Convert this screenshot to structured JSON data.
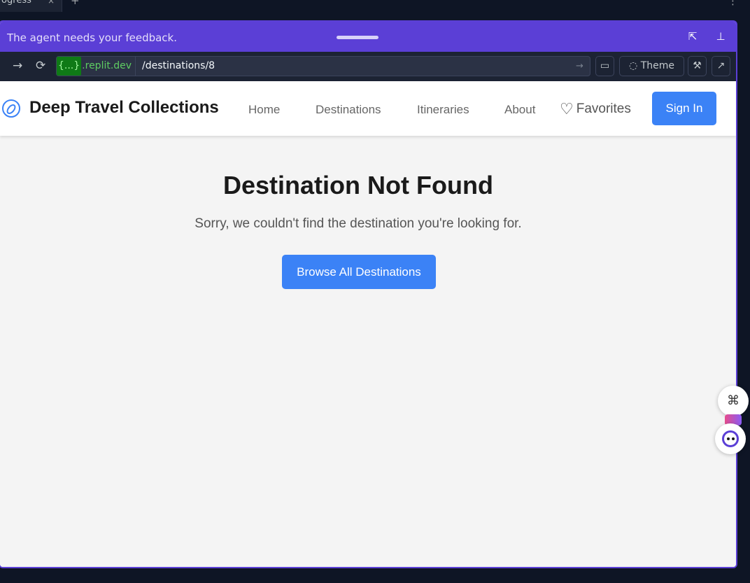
{
  "browser": {
    "tab_label": "rogress",
    "tab_close": "×",
    "tab_add": "+",
    "more": "⋮"
  },
  "feedback_bar": {
    "text": "The agent needs your feedback.",
    "accent": "#5b3fd6"
  },
  "urlbar": {
    "domain_prefix": "{...}",
    "domain": ".replit.dev",
    "path": "/destinations/8",
    "theme_label": "Theme"
  },
  "site": {
    "brand": "Deep Travel Collections",
    "nav": [
      "Home",
      "Destinations",
      "Itineraries",
      "About"
    ],
    "favorites": "Favorites",
    "sign_in": "Sign In",
    "accent": "#3b82f6"
  },
  "main": {
    "title": "Destination Not Found",
    "message": "Sorry, we couldn't find the destination you're looking for.",
    "browse_button": "Browse All Destinations"
  },
  "icons": {
    "back": "→",
    "reload": "⟳",
    "go": "→",
    "devices": "▭",
    "theme": "◌",
    "wrench": "⚒",
    "external": "↗",
    "popout": "⇱",
    "pin": "⊥",
    "heart": "♡",
    "shortcuts": "⌘"
  }
}
